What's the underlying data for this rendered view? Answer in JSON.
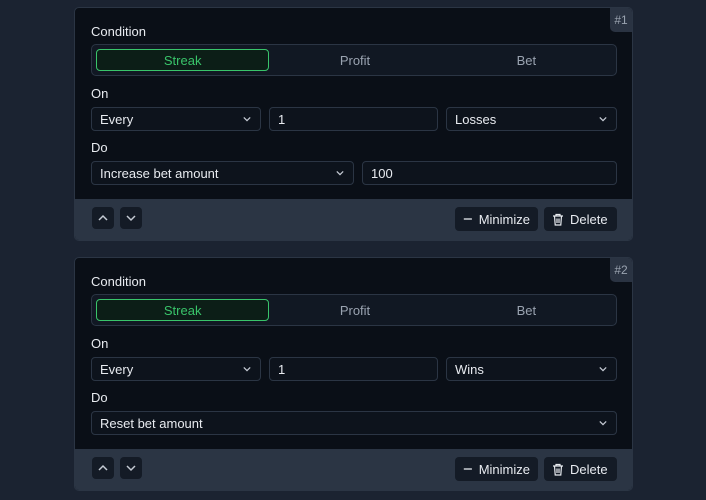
{
  "cards": [
    {
      "badge": "#1",
      "condition_label": "Condition",
      "tabs": [
        "Streak",
        "Profit",
        "Bet"
      ],
      "active_tab": "Streak",
      "on_label": "On",
      "on_frequency": "Every",
      "on_count": "1",
      "on_event": "Losses",
      "do_label": "Do",
      "do_action": "Increase bet amount",
      "do_value": "100",
      "minimize_label": "Minimize",
      "delete_label": "Delete"
    },
    {
      "badge": "#2",
      "condition_label": "Condition",
      "tabs": [
        "Streak",
        "Profit",
        "Bet"
      ],
      "active_tab": "Streak",
      "on_label": "On",
      "on_frequency": "Every",
      "on_count": "1",
      "on_event": "Wins",
      "do_label": "Do",
      "do_action": "Reset bet amount",
      "minimize_label": "Minimize",
      "delete_label": "Delete"
    }
  ],
  "colors": {
    "background": "#1b2331",
    "card": "#0a0f17",
    "footer": "#2b3544",
    "accent": "#39c46a"
  },
  "icons": [
    "chevron-down-icon",
    "chevron-up-icon",
    "minus-icon",
    "trash-icon"
  ]
}
